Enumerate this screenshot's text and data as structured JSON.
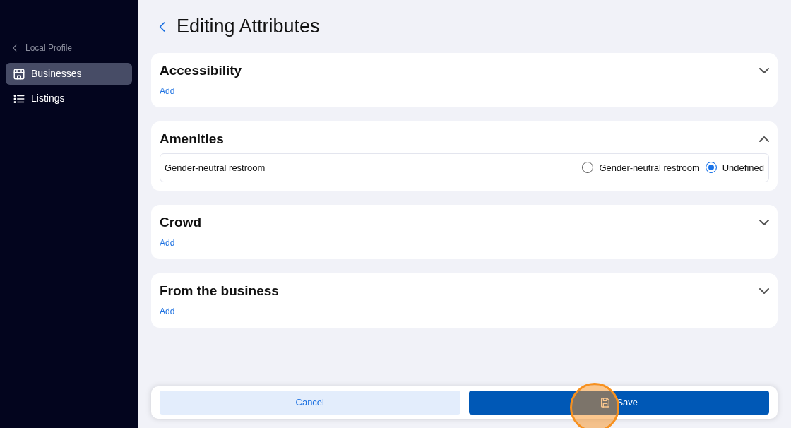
{
  "sidebar": {
    "back_label": "Local Profile",
    "items": [
      {
        "label": "Businesses",
        "selected": true
      },
      {
        "label": "Listings",
        "selected": false
      }
    ]
  },
  "page": {
    "title": "Editing Attributes"
  },
  "sections": [
    {
      "title": "Accessibility",
      "expanded": false,
      "add_label": "Add"
    },
    {
      "title": "Amenities",
      "expanded": true,
      "attributes": [
        {
          "name": "Gender-neutral restroom",
          "options": [
            {
              "label": "Gender-neutral restroom",
              "selected": false
            },
            {
              "label": "Undefined",
              "selected": true
            }
          ]
        }
      ]
    },
    {
      "title": "Crowd",
      "expanded": false,
      "add_label": "Add"
    },
    {
      "title": "From the business",
      "expanded": false,
      "add_label": "Add"
    }
  ],
  "footer": {
    "cancel_label": "Cancel",
    "save_label": "Save"
  },
  "click_highlight": true
}
